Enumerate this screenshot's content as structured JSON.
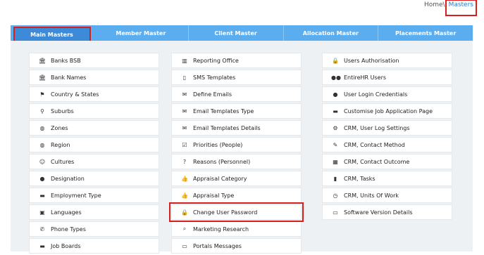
{
  "breadcrumb": {
    "home": "Home",
    "sep": "\\",
    "current": "Masters"
  },
  "tabs": [
    {
      "label": "Main Masters"
    },
    {
      "label": "Member Master"
    },
    {
      "label": "Client Master"
    },
    {
      "label": "Allocation Master"
    },
    {
      "label": "Placements Master"
    }
  ],
  "columns": [
    {
      "items": [
        {
          "icon": "bank-icon",
          "glyph": "🏛",
          "label": "Banks BSB"
        },
        {
          "icon": "bank-icon",
          "glyph": "🏛",
          "label": "Bank Names"
        },
        {
          "icon": "flag-icon",
          "glyph": "⚑",
          "label": "Country & States"
        },
        {
          "icon": "map-marker-icon",
          "glyph": "⚲",
          "label": "Suburbs"
        },
        {
          "icon": "globe-icon",
          "glyph": "◍",
          "label": "Zones"
        },
        {
          "icon": "globe-icon",
          "glyph": "◍",
          "label": "Region"
        },
        {
          "icon": "smile-icon",
          "glyph": "☺",
          "label": "Cultures"
        },
        {
          "icon": "user-icon",
          "glyph": "●",
          "label": "Designation"
        },
        {
          "icon": "briefcase-icon",
          "glyph": "▬",
          "label": "Employment Type"
        },
        {
          "icon": "language-icon",
          "glyph": "▣",
          "label": "Languages"
        },
        {
          "icon": "phone-icon",
          "glyph": "✆",
          "label": "Phone Types"
        },
        {
          "icon": "briefcase-icon",
          "glyph": "▬",
          "label": "Job Boards"
        }
      ]
    },
    {
      "items": [
        {
          "icon": "building-icon",
          "glyph": "▥",
          "label": "Reporting Office"
        },
        {
          "icon": "mobile-icon",
          "glyph": "▯",
          "label": "SMS Templates"
        },
        {
          "icon": "envelope-icon",
          "glyph": "✉",
          "label": "Define Emails"
        },
        {
          "icon": "envelope-icon",
          "glyph": "✉",
          "label": "Email Templates Type"
        },
        {
          "icon": "envelope-icon",
          "glyph": "✉",
          "label": "Email Templates Details"
        },
        {
          "icon": "check-square-icon",
          "glyph": "☑",
          "label": "Priorities (People)"
        },
        {
          "icon": "question-circle-icon",
          "glyph": "?",
          "label": "Reasons (Personnel)"
        },
        {
          "icon": "thumbs-up-icon",
          "glyph": "👍",
          "label": "Appraisal Category"
        },
        {
          "icon": "thumbs-up-icon",
          "glyph": "👍",
          "label": "Appraisal Type"
        },
        {
          "icon": "lock-icon",
          "glyph": "🔒",
          "label": "Change User Password"
        },
        {
          "icon": "search-icon",
          "glyph": "⌕",
          "label": "Marketing Research"
        },
        {
          "icon": "monitor-icon",
          "glyph": "▭",
          "label": "Portals Messages"
        }
      ]
    },
    {
      "items": [
        {
          "icon": "lock-icon",
          "glyph": "🔒",
          "label": "Users Authorisation"
        },
        {
          "icon": "users-icon",
          "glyph": "●●",
          "label": "EntireHR Users"
        },
        {
          "icon": "user-icon",
          "glyph": "●",
          "label": "User Login Credentials"
        },
        {
          "icon": "briefcase-icon",
          "glyph": "▬",
          "label": "Customise Job Application Page"
        },
        {
          "icon": "gear-icon",
          "glyph": "⚙",
          "label": "CRM, User Log Settings"
        },
        {
          "icon": "brush-icon",
          "glyph": "✎",
          "label": "CRM, Contact Method"
        },
        {
          "icon": "calendar-icon",
          "glyph": "▦",
          "label": "CRM, Contact Outcome"
        },
        {
          "icon": "file-icon",
          "glyph": "▮",
          "label": "CRM, Tasks"
        },
        {
          "icon": "clock-icon",
          "glyph": "◷",
          "label": "CRM, Units Of Work"
        },
        {
          "icon": "monitor-icon",
          "glyph": "▭",
          "label": "Software Version Details"
        }
      ]
    }
  ]
}
